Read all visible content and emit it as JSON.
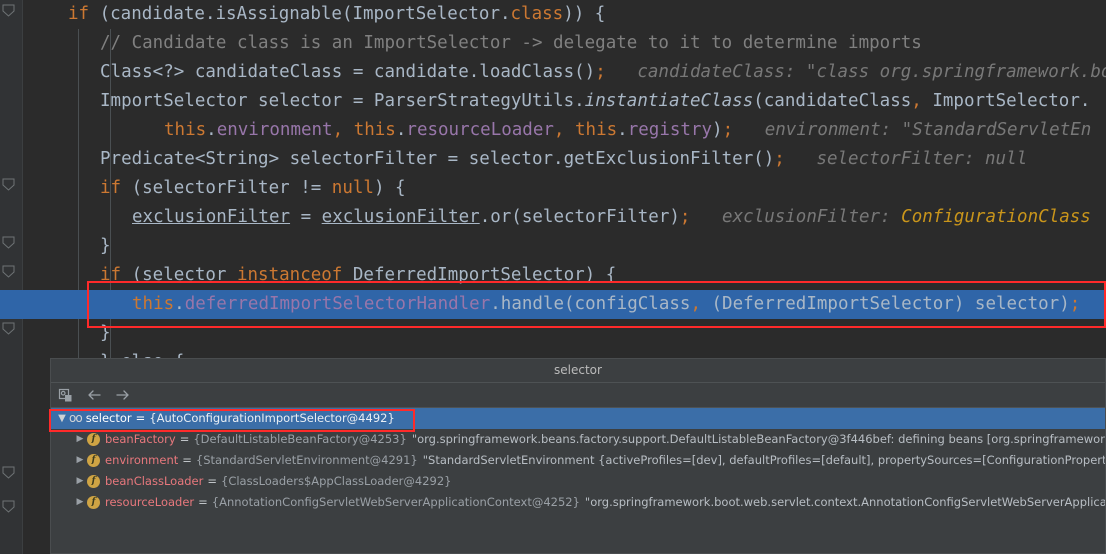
{
  "app": {
    "theme": "darcula",
    "colors": {
      "editor_bg": "#2b2b2b",
      "gutter_bg": "#313335",
      "panel_bg": "#3c3f41",
      "selection_blue": "#2f65a8",
      "tree_selection": "#3b6ea8",
      "keyword_orange": "#cc7832",
      "field_purple": "#9876aa",
      "method_yellow": "#ffc66d",
      "text_grey": "#a9b7c6",
      "hint_grey": "#787878",
      "annotation_red": "#ff2a2a"
    }
  },
  "editor": {
    "lines": [
      {
        "indent": 1,
        "tokens": [
          {
            "t": "if",
            "c": "kw"
          },
          {
            "t": " (candidate.isAssignable(ImportSelector.",
            "c": "plain"
          },
          {
            "t": "class",
            "c": "kw"
          },
          {
            "t": ")) {",
            "c": "plain"
          }
        ]
      },
      {
        "indent": 2,
        "tokens": [
          {
            "t": "// Candidate class is an ImportSelector -> delegate to it to determine imports",
            "c": "cmt"
          }
        ]
      },
      {
        "indent": 2,
        "tokens": [
          {
            "t": "Class<?> candidateClass = candidate.loadClass()",
            "c": "plain"
          },
          {
            "t": ";",
            "c": "kw"
          },
          {
            "t": "   candidateClass: \"class org.springframework.bo",
            "c": "hint"
          }
        ]
      },
      {
        "indent": 2,
        "tokens": [
          {
            "t": "ImportSelector selector = ParserStrategyUtils.",
            "c": "plain"
          },
          {
            "t": "instantiateClass",
            "c": "plain ital"
          },
          {
            "t": "(candidateClass",
            "c": "plain"
          },
          {
            "t": ",",
            "c": "kw"
          },
          {
            "t": " ImportSelector.",
            "c": "plain"
          }
        ]
      },
      {
        "indent": 4,
        "tokens": [
          {
            "t": "this",
            "c": "kw"
          },
          {
            "t": ".",
            "c": "plain"
          },
          {
            "t": "environment",
            "c": "fld"
          },
          {
            "t": ",",
            "c": "kw"
          },
          {
            "t": " ",
            "c": "plain"
          },
          {
            "t": "this",
            "c": "kw"
          },
          {
            "t": ".",
            "c": "plain"
          },
          {
            "t": "resourceLoader",
            "c": "fld"
          },
          {
            "t": ",",
            "c": "kw"
          },
          {
            "t": " ",
            "c": "plain"
          },
          {
            "t": "this",
            "c": "kw"
          },
          {
            "t": ".",
            "c": "plain"
          },
          {
            "t": "registry",
            "c": "fld"
          },
          {
            "t": ")",
            "c": "plain"
          },
          {
            "t": ";",
            "c": "kw"
          },
          {
            "t": "   environment: \"StandardServletEn",
            "c": "hint"
          }
        ]
      },
      {
        "indent": 2,
        "tokens": [
          {
            "t": "Predicate<String> selectorFilter = selector.getExclusionFilter()",
            "c": "plain"
          },
          {
            "t": ";",
            "c": "kw"
          },
          {
            "t": "   selectorFilter: null",
            "c": "hint"
          }
        ]
      },
      {
        "indent": 2,
        "tokens": [
          {
            "t": "if",
            "c": "kw"
          },
          {
            "t": " (selectorFilter != ",
            "c": "plain"
          },
          {
            "t": "null",
            "c": "kw"
          },
          {
            "t": ") {",
            "c": "plain"
          }
        ]
      },
      {
        "indent": 3,
        "tokens": [
          {
            "t": "exclusionFilter",
            "c": "plain und"
          },
          {
            "t": " = ",
            "c": "plain"
          },
          {
            "t": "exclusionFilter",
            "c": "plain und"
          },
          {
            "t": ".or(selectorFilter)",
            "c": "plain"
          },
          {
            "t": ";",
            "c": "kw"
          },
          {
            "t": "   exclusionFilter: ",
            "c": "hint"
          },
          {
            "t": "ConfigurationClass",
            "c": "hintwarn"
          }
        ]
      },
      {
        "indent": 2,
        "tokens": [
          {
            "t": "}",
            "c": "plain"
          }
        ]
      },
      {
        "indent": 2,
        "tokens": [
          {
            "t": "if",
            "c": "kw"
          },
          {
            "t": " (selector ",
            "c": "plain"
          },
          {
            "t": "instanceof",
            "c": "kw"
          },
          {
            "t": " DeferredImportSelector) {",
            "c": "plain"
          }
        ]
      },
      {
        "indent": 3,
        "highlight": true,
        "tokens": [
          {
            "t": "this",
            "c": "kw"
          },
          {
            "t": ".",
            "c": "plain"
          },
          {
            "t": "deferredImportSelectorHandler",
            "c": "fld"
          },
          {
            "t": ".handle(configClass",
            "c": "plain"
          },
          {
            "t": ",",
            "c": "kw"
          },
          {
            "t": " (DeferredImportSelector) selector)",
            "c": "plain"
          },
          {
            "t": ";",
            "c": "kw"
          }
        ]
      },
      {
        "indent": 2,
        "tokens": [
          {
            "t": "}",
            "c": "plain"
          }
        ]
      },
      {
        "indent": 2,
        "tokens": [
          {
            "t": "} else {",
            "c": "plain"
          }
        ]
      }
    ],
    "bottom_lines": [
      {
        "indent": 1,
        "tokens": [
          {
            "t": "}",
            "c": "plain"
          }
        ]
      },
      {
        "indent": 1,
        "tokens": [
          {
            "t": "els",
            "c": "kw"
          }
        ]
      }
    ]
  },
  "popup": {
    "title": "selector",
    "toolbar": [
      {
        "name": "evaluate-expression-icon",
        "glyph": "evaluate"
      },
      {
        "name": "back-arrow-icon",
        "glyph": "←"
      },
      {
        "name": "forward-arrow-icon",
        "glyph": "→"
      }
    ],
    "tree": [
      {
        "expanded": true,
        "selected": true,
        "icon": "oo",
        "name": "selector",
        "eq": "=",
        "type": "{AutoConfigurationImportSelector@4492}",
        "value": ""
      },
      {
        "expanded": false,
        "selected": false,
        "icon": "f",
        "name": "beanFactory",
        "eq": "=",
        "type": "{DefaultListableBeanFactory@4253}",
        "value": "\"org.springframework.beans.factory.support.DefaultListableBeanFactory@3f446bef: defining beans [org.springframework"
      },
      {
        "expanded": false,
        "selected": false,
        "icon": "f",
        "name": "environment",
        "eq": "=",
        "type": "{StandardServletEnvironment@4291}",
        "value": "\"StandardServletEnvironment {activeProfiles=[dev], defaultProfiles=[default], propertySources=[ConfigurationPropertyS"
      },
      {
        "expanded": false,
        "selected": false,
        "icon": "f",
        "name": "beanClassLoader",
        "eq": "=",
        "type": "{ClassLoaders$AppClassLoader@4292}",
        "value": ""
      },
      {
        "expanded": false,
        "selected": false,
        "icon": "f",
        "name": "resourceLoader",
        "eq": "=",
        "type": "{AnnotationConfigServletWebServerApplicationContext@4252}",
        "value": "\"org.springframework.boot.web.servlet.context.AnnotationConfigServletWebServerApplica"
      }
    ]
  },
  "annotations": {
    "code_highlight_box": "this.deferredImportSelectorHandler.handle(configClass, (DeferredImportSelector) selector);",
    "tree_highlight_box": "selector = {AutoConfigurationImportSelector@4492}"
  }
}
